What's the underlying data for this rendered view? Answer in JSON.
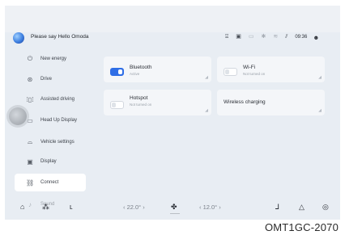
{
  "status_bar": {
    "assistant_prompt": "Please say Hello Omoda",
    "time": "09:36",
    "icons": [
      "a-icon",
      "message-icon",
      "battery-icon",
      "bluetooth-icon",
      "wifi-icon",
      "signal-icon",
      "user-icon"
    ]
  },
  "sidebar": {
    "items": [
      {
        "label": "New energy",
        "icon": "energy-icon"
      },
      {
        "label": "Drive",
        "icon": "steering-icon"
      },
      {
        "label": "Assisted driving",
        "icon": "lane-icon"
      },
      {
        "label": "Head Up Display",
        "icon": "hud-icon"
      },
      {
        "label": "Vehicle settings",
        "icon": "car-icon"
      },
      {
        "label": "Display",
        "icon": "display-icon"
      },
      {
        "label": "Connect",
        "icon": "link-icon",
        "active": true
      },
      {
        "label": "Sound",
        "icon": "sound-icon"
      }
    ]
  },
  "cards": {
    "bluetooth": {
      "title": "Bluetooth",
      "sub": "Active",
      "on": true
    },
    "wifi": {
      "title": "Wi-Fi",
      "sub": "Not turned on",
      "on": false
    },
    "hotspot": {
      "title": "Hotspot",
      "sub": "Not turned on",
      "on": false
    },
    "wireless": {
      "title": "Wireless charging"
    }
  },
  "dock": {
    "left_temp": "‹  22.0° ›",
    "right_temp": "‹  12.0° ›"
  },
  "figure_code": "OMT1GC-2070"
}
